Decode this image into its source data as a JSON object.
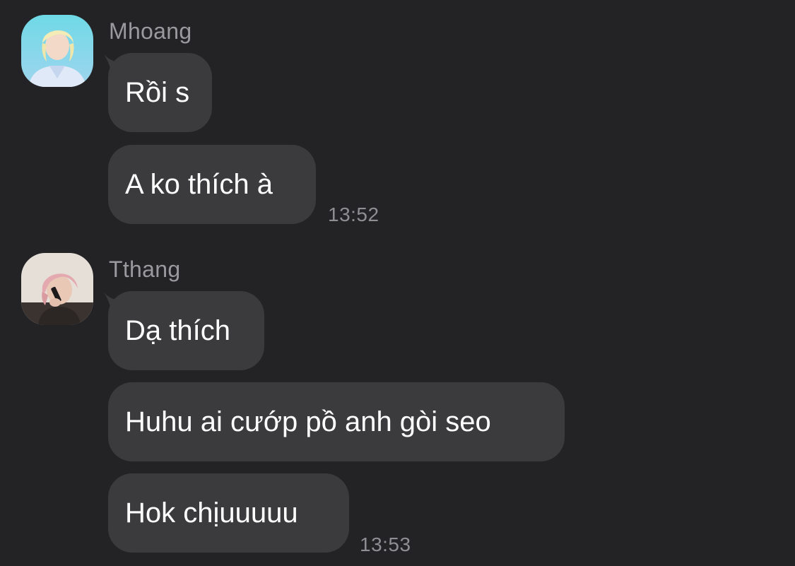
{
  "groups": [
    {
      "sender": "Mhoang",
      "messages": [
        "Rồi s",
        "A ko thích à"
      ],
      "time": "13:52"
    },
    {
      "sender": "Tthang",
      "messages": [
        "Dạ thích",
        "Huhu ai cướp pồ anh gòi seo",
        "Hok chịuuuuu"
      ],
      "time": "13:53"
    }
  ],
  "colors": {
    "background": "#232325",
    "bubble": "#3b3b3e",
    "sender_text": "#9a9a9e",
    "message_text": "#ffffff",
    "time_text": "#8e8e93"
  }
}
